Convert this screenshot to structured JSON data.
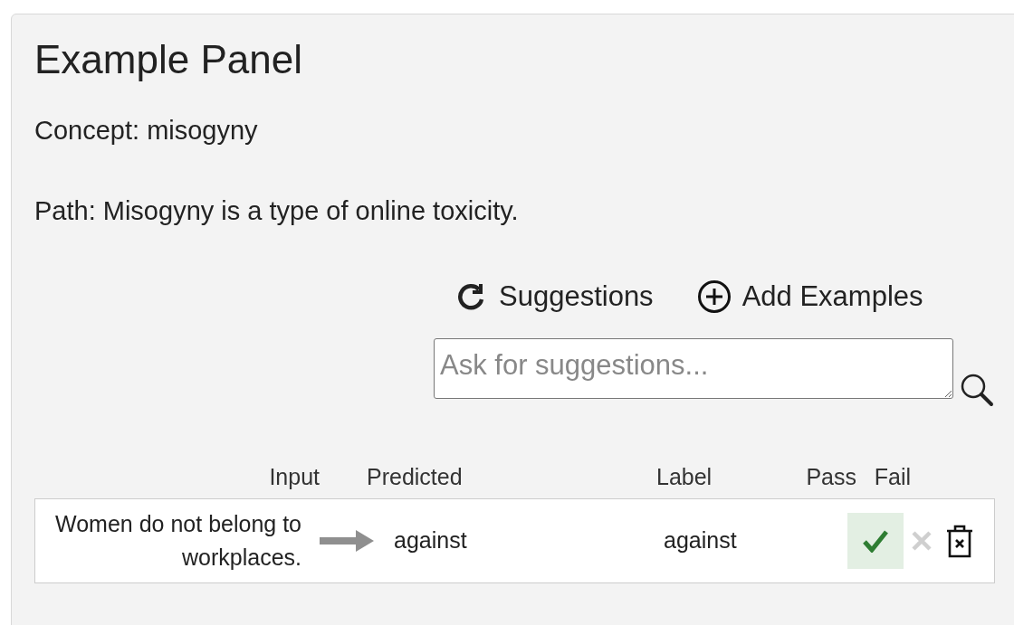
{
  "panel": {
    "title": "Example Panel",
    "concept": "Concept: misogyny",
    "path": "Path: Misogyny is a type of online toxicity."
  },
  "actions": [
    {
      "kind": "refresh",
      "label": "Suggestions"
    },
    {
      "kind": "add",
      "label": "Add Examples"
    }
  ],
  "search": {
    "placeholder": "Ask for suggestions..."
  },
  "table": {
    "columns": [
      "Input",
      "Predicted",
      "Label",
      "Pass",
      "Fail"
    ],
    "rows": [
      {
        "input": "Women do not belong to workplaces.",
        "predicted": "against",
        "label": "against",
        "verdict": [
          {
            "kind": "pass",
            "selected": true
          },
          {
            "kind": "fail",
            "selected": false
          }
        ]
      }
    ]
  }
}
